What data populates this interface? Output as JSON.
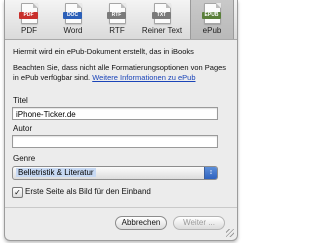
{
  "tabs": [
    {
      "label": "PDF",
      "tag": "PDF",
      "color": "#c9302c",
      "active": false
    },
    {
      "label": "Word",
      "tag": "DOC",
      "color": "#2b5fb8",
      "active": false
    },
    {
      "label": "RTF",
      "tag": "RTF",
      "color": "#7a7a7a",
      "active": false
    },
    {
      "label": "Reiner Text",
      "tag": "TXT",
      "color": "#7a7a7a",
      "active": false
    },
    {
      "label": "ePub",
      "tag": "EPUB",
      "color": "#5a7f3a",
      "active": true
    }
  ],
  "description": {
    "line1": "Hiermit wird ein ePub-Dokument erstellt, das in iBooks",
    "line2_prefix": "Beachten Sie, dass nicht alle Formatierungsoptionen von Pages in ePub verfügbar sind.",
    "link": "Weitere Informationen zu ePub"
  },
  "fields": {
    "title_label": "Titel",
    "title_value": "iPhone-Ticker.de",
    "author_label": "Autor",
    "author_value": "",
    "genre_label": "Genre",
    "genre_value": "Belletristik & Literatur"
  },
  "checkbox": {
    "label": "Erste Seite als Bild für den Einband",
    "checked": true
  },
  "buttons": {
    "cancel": "Abbrechen",
    "next": "Weiter ..."
  }
}
